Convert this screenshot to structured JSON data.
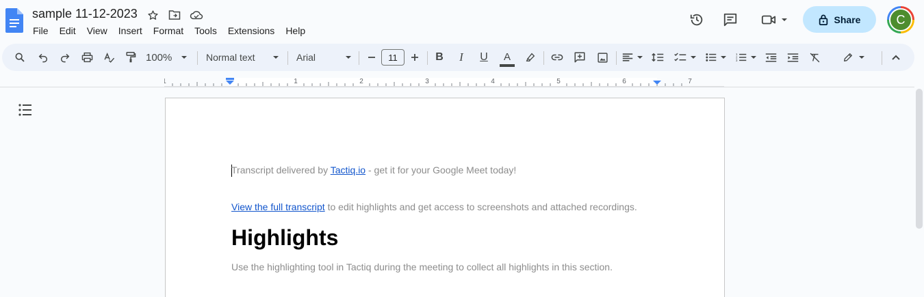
{
  "document": {
    "title": "sample 11-12-2023"
  },
  "menu": [
    "File",
    "Edit",
    "View",
    "Insert",
    "Format",
    "Tools",
    "Extensions",
    "Help"
  ],
  "header": {
    "share_label": "Share",
    "avatar_letter": "C"
  },
  "toolbar": {
    "zoom": "100%",
    "style": "Normal text",
    "font": "Arial",
    "font_size": "11",
    "text_color": "#444746"
  },
  "ruler": {
    "labels": [
      "1",
      "1",
      "2",
      "3",
      "4",
      "5",
      "6",
      "7"
    ]
  },
  "content": {
    "line1_prefix": "Transcript delivered by ",
    "line1_link": "Tactiq.io",
    "line1_suffix": " - get it for your Google Meet today!",
    "line2_link": "View the full transcript",
    "line2_suffix": " to edit highlights and get access to screenshots and attached recordings.",
    "heading": "Highlights",
    "line3": "Use the highlighting tool in Tactiq during the meeting to collect all highlights in this section."
  },
  "icons": {
    "docs": "docs-icon",
    "star": "star-icon",
    "move": "move-to-folder-icon",
    "cloud": "cloud-status-icon",
    "history": "version-history-icon",
    "comments": "comments-icon",
    "meet": "meet-video-icon",
    "lock": "lock-icon",
    "outline": "document-outline-icon"
  },
  "colors": {
    "share_bg": "#c2e7ff",
    "toolbar_bg": "#edf2fa",
    "link": "#1155cc",
    "avatar": "#4d8d2e"
  }
}
